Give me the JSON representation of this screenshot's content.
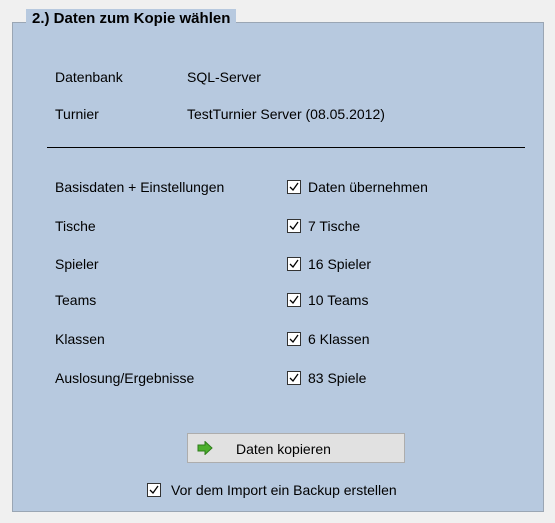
{
  "group": {
    "title": "2.) Daten zum Kopie wählen",
    "datenbank_label": "Datenbank",
    "datenbank_value": "SQL-Server",
    "turnier_label": "Turnier",
    "turnier_value": "TestTurnier Server (08.05.2012)"
  },
  "items": [
    {
      "label": "Basisdaten + Einstellungen",
      "checked": true,
      "value": "Daten übernehmen"
    },
    {
      "label": "Tische",
      "checked": true,
      "value": "7 Tische"
    },
    {
      "label": "Spieler",
      "checked": true,
      "value": "16 Spieler"
    },
    {
      "label": "Teams",
      "checked": true,
      "value": "10 Teams"
    },
    {
      "label": "Klassen",
      "checked": true,
      "value": "6 Klassen"
    },
    {
      "label": "Auslosung/Ergebnisse",
      "checked": true,
      "value": "83 Spiele"
    }
  ],
  "copy_button": {
    "label": "Daten kopieren",
    "icon": "green-arrow-right-icon"
  },
  "backup": {
    "checked": true,
    "label": "Vor dem Import ein Backup erstellen"
  }
}
